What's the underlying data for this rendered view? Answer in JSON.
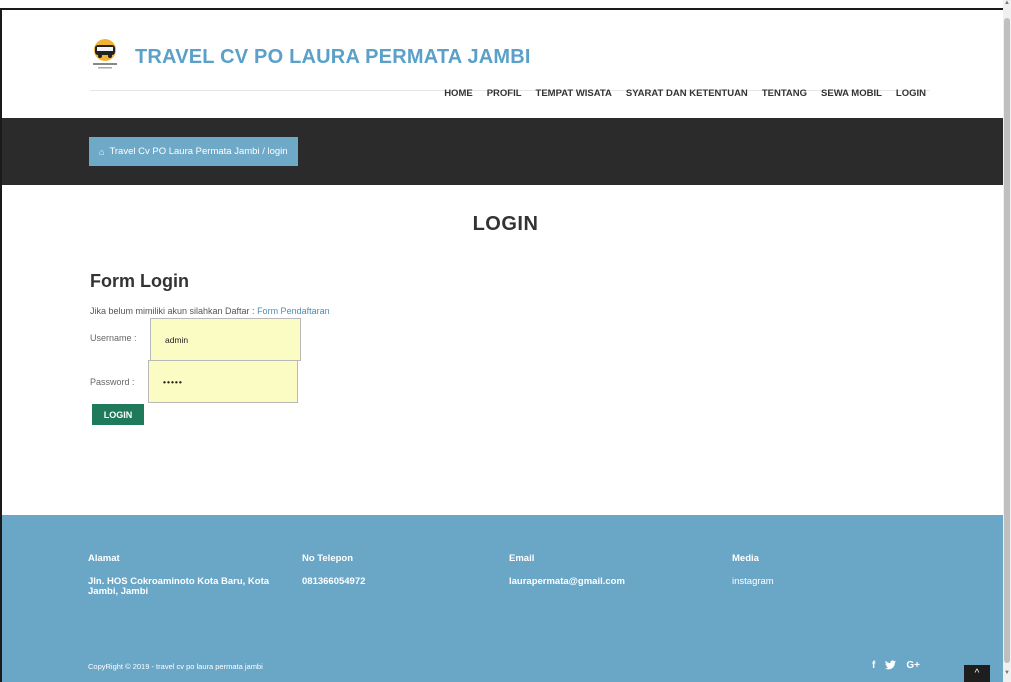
{
  "header": {
    "brand": "TRAVEL CV PO LAURA PERMATA JAMBI",
    "logo_icon": "bus-emblem-icon",
    "nav": [
      {
        "label": "HOME"
      },
      {
        "label": "PROFIL"
      },
      {
        "label": "TEMPAT WISATA"
      },
      {
        "label": "SYARAT DAN KETENTUAN"
      },
      {
        "label": "TENTANG"
      },
      {
        "label": "SEWA MOBIL"
      },
      {
        "label": "LOGIN"
      }
    ]
  },
  "banner": {
    "home_icon": "home-icon",
    "breadcrumb": "Travel Cv PO Laura Permata Jambi / login"
  },
  "main": {
    "title": "LOGIN",
    "form_title": "Form Login",
    "note_text": "Jika belum mimiliki akun silahkan Daftar : ",
    "note_link": "Form Pendaftaran",
    "username_label": "Username :",
    "username_value": "admin",
    "password_label": "Password :",
    "password_value": "•••••",
    "login_button": "LOGIN"
  },
  "footer": {
    "address_heading": "Alamat",
    "address_value": "Jln. HOS Cokroaminoto Kota Baru, Kota Jambi, Jambi",
    "phone_heading": "No Telepon",
    "phone_value": "081366054972",
    "email_heading": "Email",
    "email_value": "laurapermata@gmail.com",
    "media_heading": "Media",
    "media_value": "instagram",
    "copyright": "CopyRight © 2019 - travel cv po laura permata jambi",
    "social": {
      "facebook": "f",
      "twitter": "🐦",
      "google": "G+"
    },
    "to_top_icon": "chevron-up-icon"
  },
  "colors": {
    "brand": "#5aa0c8",
    "banner_bg": "#2b2b2b",
    "breadcrumb_bg": "#6fa9c8",
    "input_bg": "#fbfcc4",
    "button_bg": "#1e7a5a",
    "footer_bg": "#6aa7c7"
  }
}
